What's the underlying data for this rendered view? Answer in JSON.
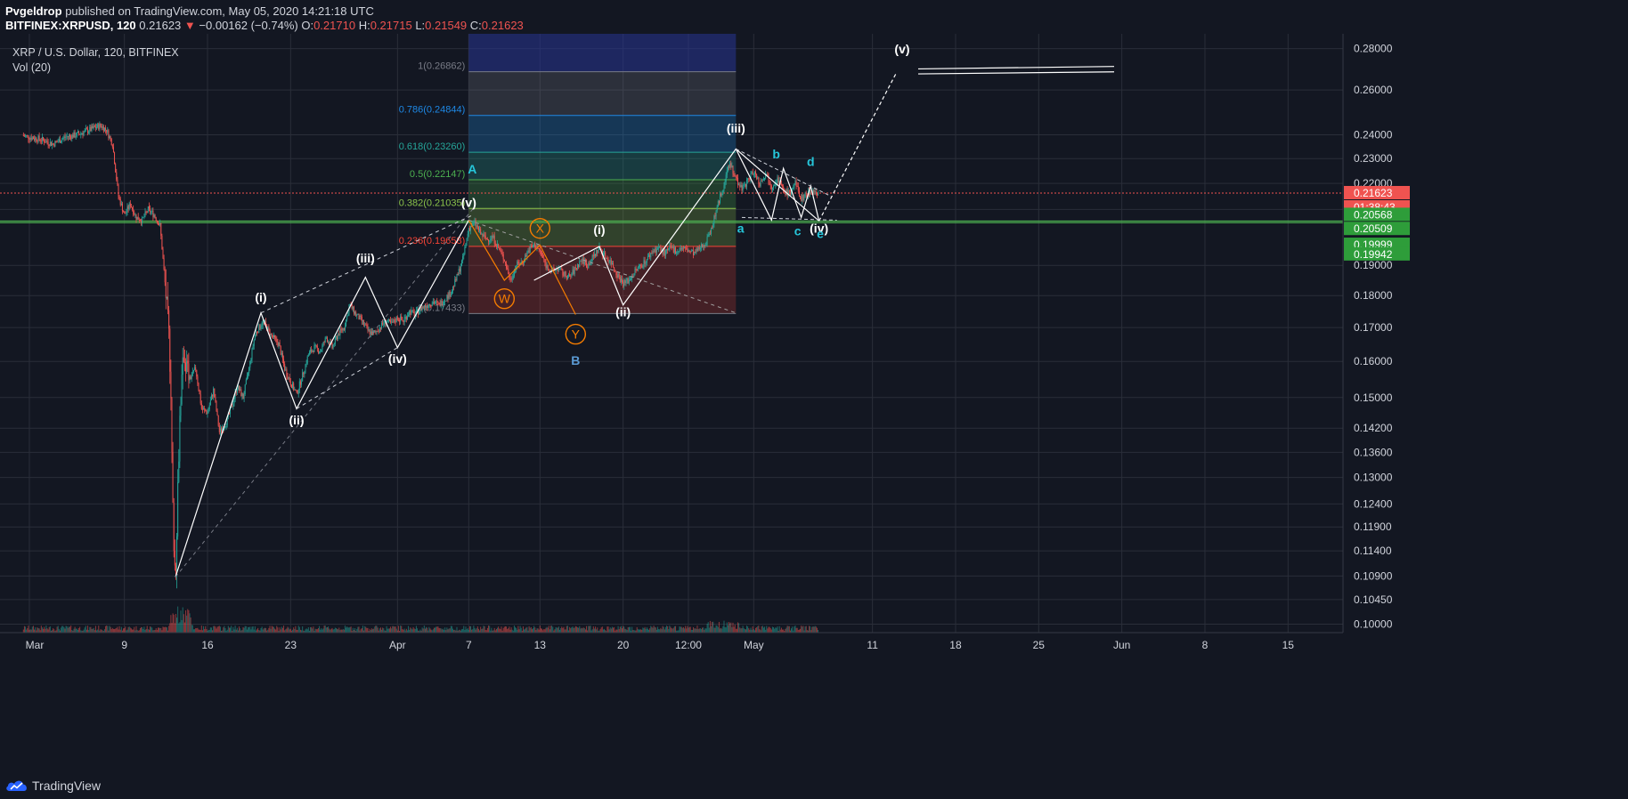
{
  "header": {
    "published_by": "Pvgeldrop",
    "published_text": "published on TradingView.com, May 05, 2020 14:21:18 UTC",
    "symbol": "BITFINEX:XRPUSD, 120",
    "last": "0.21623",
    "arrow": "▼",
    "change": "−0.00162 (−0.74%)",
    "o_label": "O:",
    "o_value": "0.21710",
    "h_label": "H:",
    "h_value": "0.21715",
    "l_label": "L:",
    "l_value": "0.21549",
    "c_label": "C:",
    "c_value": "0.21623"
  },
  "legend": {
    "title": "XRP / U.S. Dollar, 120, BITFINEX",
    "volume": "Vol (20)"
  },
  "footer": {
    "brand": "TradingView"
  },
  "colors": {
    "background": "#131722",
    "up": "#26a69a",
    "down": "#ef5350",
    "grid": "#2a2e39",
    "wave": "#ffffff",
    "cyan_label": "#26c6da",
    "orange": "#f57c00",
    "blue_label": "#5b9bd5",
    "last_price_badge": "#ef5350",
    "level_badge": "#2e9d3a"
  },
  "chart_data": {
    "type": "candlestick",
    "scale": "log",
    "ylim": [
      0.0985,
      0.2875
    ],
    "price_ticks": [
      "0.28000",
      "0.26000",
      "0.24000",
      "0.23000",
      "0.22000",
      "0.21000",
      "0.19000",
      "0.18000",
      "0.17000",
      "0.16000",
      "0.15000",
      "0.14200",
      "0.13600",
      "0.13000",
      "0.12400",
      "0.11900",
      "0.11400",
      "0.10900",
      "0.10450",
      "0.10000"
    ],
    "time_ticks": [
      {
        "label": "Mar",
        "d": 0
      },
      {
        "label": "9",
        "d": 8
      },
      {
        "label": "16",
        "d": 15
      },
      {
        "label": "23",
        "d": 22
      },
      {
        "label": "Apr",
        "d": 31
      },
      {
        "label": "7",
        "d": 37
      },
      {
        "label": "13",
        "d": 43
      },
      {
        "label": "20",
        "d": 50
      },
      {
        "label": "12:00",
        "d": 55.5
      },
      {
        "label": "May",
        "d": 61
      },
      {
        "label": "11",
        "d": 71
      },
      {
        "label": "18",
        "d": 78
      },
      {
        "label": "25",
        "d": 85
      },
      {
        "label": "Jun",
        "d": 92
      },
      {
        "label": "8",
        "d": 99
      },
      {
        "label": "15",
        "d": 106
      }
    ],
    "price_path": [
      [
        -1,
        0.24
      ],
      [
        0,
        0.239
      ],
      [
        1,
        0.238
      ],
      [
        2,
        0.236
      ],
      [
        3,
        0.239
      ],
      [
        4,
        0.24
      ],
      [
        5,
        0.242
      ],
      [
        6,
        0.244
      ],
      [
        6.5,
        0.242
      ],
      [
        7,
        0.236
      ],
      [
        7.5,
        0.215
      ],
      [
        8,
        0.208
      ],
      [
        8.5,
        0.212
      ],
      [
        9,
        0.207
      ],
      [
        9.5,
        0.206
      ],
      [
        10,
        0.21
      ],
      [
        10.5,
        0.208
      ],
      [
        11,
        0.204
      ],
      [
        11.4,
        0.185
      ],
      [
        11.8,
        0.165
      ],
      [
        12.1,
        0.12
      ],
      [
        12.3,
        0.108
      ],
      [
        12.7,
        0.148
      ],
      [
        13,
        0.162
      ],
      [
        13.5,
        0.155
      ],
      [
        14,
        0.158
      ],
      [
        14.5,
        0.147
      ],
      [
        15,
        0.146
      ],
      [
        15.5,
        0.152
      ],
      [
        16,
        0.141
      ],
      [
        16.5,
        0.143
      ],
      [
        17,
        0.147
      ],
      [
        17.5,
        0.153
      ],
      [
        18,
        0.15
      ],
      [
        18.5,
        0.158
      ],
      [
        19,
        0.168
      ],
      [
        19.7,
        0.172
      ],
      [
        20.3,
        0.168
      ],
      [
        21,
        0.165
      ],
      [
        21.5,
        0.158
      ],
      [
        22,
        0.154
      ],
      [
        22.5,
        0.151
      ],
      [
        23,
        0.156
      ],
      [
        23.5,
        0.162
      ],
      [
        24,
        0.164
      ],
      [
        24.5,
        0.163
      ],
      [
        25,
        0.167
      ],
      [
        25.5,
        0.164
      ],
      [
        26,
        0.168
      ],
      [
        26.5,
        0.17
      ],
      [
        27,
        0.177
      ],
      [
        27.5,
        0.174
      ],
      [
        28,
        0.172
      ],
      [
        28.5,
        0.169
      ],
      [
        29,
        0.168
      ],
      [
        29.5,
        0.17
      ],
      [
        30,
        0.172
      ],
      [
        30.5,
        0.171
      ],
      [
        31,
        0.173
      ],
      [
        31.5,
        0.172
      ],
      [
        32,
        0.175
      ],
      [
        32.5,
        0.174
      ],
      [
        33,
        0.176
      ],
      [
        33.5,
        0.177
      ],
      [
        34,
        0.178
      ],
      [
        34.5,
        0.177
      ],
      [
        35,
        0.179
      ],
      [
        35.5,
        0.181
      ],
      [
        36,
        0.186
      ],
      [
        36.5,
        0.192
      ],
      [
        37,
        0.203
      ],
      [
        37.5,
        0.205
      ],
      [
        38,
        0.201
      ],
      [
        38.5,
        0.199
      ],
      [
        39,
        0.2
      ],
      [
        39.5,
        0.196
      ],
      [
        40,
        0.192
      ],
      [
        40.5,
        0.185
      ],
      [
        41,
        0.19
      ],
      [
        41.5,
        0.191
      ],
      [
        42,
        0.195
      ],
      [
        42.5,
        0.197
      ],
      [
        43,
        0.195
      ],
      [
        43.5,
        0.19
      ],
      [
        44,
        0.188
      ],
      [
        44.5,
        0.189
      ],
      [
        45,
        0.187
      ],
      [
        45.5,
        0.186
      ],
      [
        46,
        0.189
      ],
      [
        46.5,
        0.192
      ],
      [
        47,
        0.19
      ],
      [
        47.5,
        0.193
      ],
      [
        48,
        0.196
      ],
      [
        48.5,
        0.193
      ],
      [
        49,
        0.191
      ],
      [
        49.5,
        0.187
      ],
      [
        50,
        0.184
      ],
      [
        50.5,
        0.185
      ],
      [
        51,
        0.188
      ],
      [
        51.5,
        0.19
      ],
      [
        52,
        0.192
      ],
      [
        52.5,
        0.195
      ],
      [
        53,
        0.196
      ],
      [
        53.5,
        0.194
      ],
      [
        54,
        0.196
      ],
      [
        54.5,
        0.195
      ],
      [
        55,
        0.196
      ],
      [
        55.5,
        0.195
      ],
      [
        56,
        0.194
      ],
      [
        56.5,
        0.196
      ],
      [
        57,
        0.198
      ],
      [
        57.5,
        0.204
      ],
      [
        58,
        0.212
      ],
      [
        58.5,
        0.22
      ],
      [
        59,
        0.228
      ],
      [
        59.5,
        0.222
      ],
      [
        60,
        0.218
      ],
      [
        60.5,
        0.221
      ],
      [
        61,
        0.225
      ],
      [
        61.5,
        0.22
      ],
      [
        62,
        0.224
      ],
      [
        62.5,
        0.219
      ],
      [
        63,
        0.222
      ],
      [
        63.5,
        0.217
      ],
      [
        64,
        0.216
      ],
      [
        64.5,
        0.22
      ],
      [
        65,
        0.214
      ],
      [
        65.5,
        0.216
      ],
      [
        66,
        0.217
      ],
      [
        66.5,
        0.216
      ]
    ],
    "fib_levels": [
      {
        "label": "1(0.26862)",
        "price": 0.26862,
        "color": "#787b86",
        "fill": "rgba(120,123,134,0.25)"
      },
      {
        "label": "0.786(0.24844)",
        "price": 0.24844,
        "color": "#1e88e5",
        "fill": "rgba(33,150,243,0.25)"
      },
      {
        "label": "0.618(0.23260)",
        "price": 0.2326,
        "color": "#26a69a",
        "fill": "rgba(38,166,154,0.25)"
      },
      {
        "label": "0.5(0.22147)",
        "price": 0.22147,
        "color": "#4caf50",
        "fill": "rgba(76,175,80,0.25)"
      },
      {
        "label": "0.382(0.21035)",
        "price": 0.21035,
        "color": "#8bc34a",
        "fill": "rgba(139,195,74,0.25)"
      },
      {
        "label": "0.236(0.19658)",
        "price": 0.19658,
        "color": "#f44336",
        "fill": "rgba(244,67,54,0.22)"
      },
      {
        "label": "0(0.17433)",
        "price": 0.17433,
        "color": "#787b86",
        "fill": null
      }
    ],
    "fib_top_band": {
      "top": 0.2875,
      "color": "rgba(40,53,147,0.55)"
    },
    "fib_range_days": [
      37,
      59.5
    ],
    "horizontal_lines": [
      0.20568,
      0.20509
    ],
    "last_price_line": 0.21623,
    "price_badges": [
      {
        "text": "0.21623",
        "price": 0.21623,
        "color": "#ef5350"
      },
      {
        "text": "01:38:43",
        "price": 0.21623,
        "color": "#ef5350",
        "offset": 1
      },
      {
        "text": "0.20568",
        "price": 0.20568,
        "color": "#2e9d3a"
      },
      {
        "text": "0.20509",
        "price": 0.20509,
        "color": "#2e9d3a"
      },
      {
        "text": "0.19999",
        "price": 0.19999,
        "color": "#2e9d3a"
      },
      {
        "text": "0.19942",
        "price": 0.19942,
        "color": "#2e9d3a"
      }
    ],
    "wave_impulse_1": [
      [
        12.3,
        0.1088
      ],
      [
        19.5,
        0.1745
      ],
      [
        22.5,
        0.147
      ],
      [
        28.3,
        0.186
      ],
      [
        31,
        0.164
      ],
      [
        37,
        0.206
      ]
    ],
    "wave_impulse_2": [
      [
        42.5,
        0.185
      ],
      [
        48,
        0.1965
      ],
      [
        50,
        0.177
      ],
      [
        59.5,
        0.234
      ],
      [
        66.5,
        0.2057
      ],
      [
        73,
        0.268
      ]
    ],
    "wxy": [
      [
        37,
        0.206
      ],
      [
        40,
        0.185
      ],
      [
        43,
        0.197
      ],
      [
        46,
        0.174
      ]
    ],
    "triangle": [
      [
        59.5,
        0.234
      ],
      [
        62.5,
        0.206
      ],
      [
        63.5,
        0.226
      ],
      [
        65,
        0.207
      ],
      [
        65.8,
        0.219
      ],
      [
        66.5,
        0.2057
      ]
    ],
    "annotations": [
      {
        "text": "(i)",
        "d": 19.5,
        "p": 0.178,
        "color": "#ffffff"
      },
      {
        "text": "(ii)",
        "d": 22.5,
        "p": 0.143,
        "color": "#ffffff"
      },
      {
        "text": "(iii)",
        "d": 28.3,
        "p": 0.191,
        "color": "#ffffff"
      },
      {
        "text": "(iv)",
        "d": 31,
        "p": 0.1595,
        "color": "#ffffff"
      },
      {
        "text": "(v)",
        "d": 37,
        "p": 0.211,
        "color": "#ffffff"
      },
      {
        "text": "(i)",
        "d": 48,
        "p": 0.201,
        "color": "#ffffff"
      },
      {
        "text": "(ii)",
        "d": 50,
        "p": 0.1735,
        "color": "#ffffff"
      },
      {
        "text": "(iii)",
        "d": 59.5,
        "p": 0.241,
        "color": "#ffffff"
      },
      {
        "text": "(iv)",
        "d": 66.5,
        "p": 0.2015,
        "color": "#ffffff"
      },
      {
        "text": "(v)",
        "d": 73.5,
        "p": 0.2775,
        "color": "#ffffff"
      },
      {
        "text": "A",
        "d": 37.3,
        "p": 0.224,
        "color": "#26c6da"
      },
      {
        "text": "B",
        "d": 46,
        "p": 0.159,
        "color": "#5b9bd5"
      },
      {
        "text": "a",
        "d": 59.9,
        "p": 0.2015,
        "color": "#26c6da"
      },
      {
        "text": "b",
        "d": 62.9,
        "p": 0.23,
        "color": "#26c6da"
      },
      {
        "text": "c",
        "d": 64.7,
        "p": 0.2005,
        "color": "#26c6da"
      },
      {
        "text": "d",
        "d": 65.8,
        "p": 0.227,
        "color": "#26c6da"
      },
      {
        "text": "e",
        "d": 66.6,
        "p": 0.1995,
        "color": "#26c6da"
      }
    ],
    "circle_labels": [
      {
        "text": "W",
        "d": 40,
        "p": 0.179
      },
      {
        "text": "X",
        "d": 43,
        "p": 0.203
      },
      {
        "text": "Y",
        "d": 46,
        "p": 0.168
      }
    ]
  }
}
